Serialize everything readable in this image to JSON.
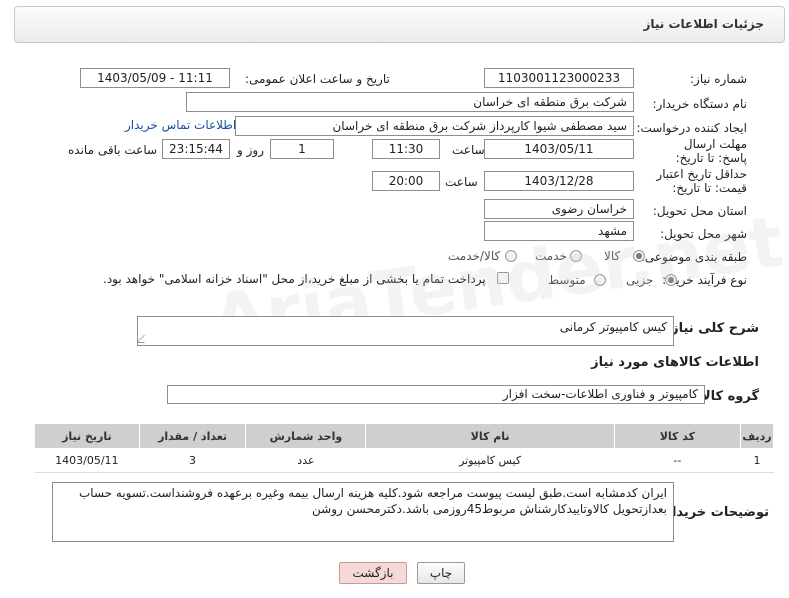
{
  "header": {
    "title": "جزئیات اطلاعات نیاز"
  },
  "need_number": {
    "label": "شماره نیاز:",
    "value": "1103001123000233"
  },
  "announce": {
    "label": "تاریخ و ساعت اعلان عمومی:",
    "value": "1403/05/09 - 11:11"
  },
  "buyer_org": {
    "label": "نام دستگاه خریدار:",
    "value": "شرکت برق منطقه ای خراسان"
  },
  "requester": {
    "label": "ایجاد کننده درخواست:",
    "value": "سید مصطفی شیوا کارپرداز شرکت برق منطقه ای خراسان",
    "contact_link": "اطلاعات تماس خریدار"
  },
  "reply_deadline": {
    "label": "مهلت ارسال پاسخ: تا تاریخ:",
    "date": "1403/05/11",
    "time_label": "ساعت",
    "time": "11:30",
    "days": "1",
    "days_label": "روز و",
    "remaining": "23:15:44",
    "remaining_label": "ساعت باقی مانده"
  },
  "price_validity": {
    "label": "حداقل تاریخ اعتبار قیمت: تا تاریخ:",
    "date": "1403/12/28",
    "time_label": "ساعت",
    "time": "20:00"
  },
  "province": {
    "label": "استان محل تحویل:",
    "value": "خراسان رضوی"
  },
  "city": {
    "label": "شهر محل تحویل:",
    "value": "مشهد"
  },
  "category": {
    "label": "طبقه بندی موضوعی:",
    "options": [
      "کالا",
      "خدمت",
      "کالا/خدمت"
    ]
  },
  "purchase_type": {
    "label": "نوع فرآیند خرید :",
    "options": [
      "جزیی",
      "متوسط"
    ],
    "payment_note": "پرداخت تمام یا بخشی از مبلغ خرید،از محل \"اسناد خزانه اسلامی\" خواهد بود."
  },
  "description": {
    "label": "شرح کلی نیاز:",
    "value": "کیس کامپیوتر کرمانی"
  },
  "goods_section": {
    "title": "اطلاعات کالاهای مورد نیاز"
  },
  "goods_group": {
    "label": "گروه کالا:",
    "value": "کامپیوتر و فناوری اطلاعات-سخت افزار"
  },
  "table": {
    "headers": [
      "ردیف",
      "کد کالا",
      "نام کالا",
      "واحد شمارش",
      "تعداد / مقدار",
      "تاریخ نیاز"
    ],
    "rows": [
      [
        "1",
        "--",
        "کیس کامپیوتر",
        "عدد",
        "3",
        "1403/05/11"
      ]
    ]
  },
  "buyer_notes": {
    "label": "توضیحات خریدار:",
    "value": "ایران کدمشابه است.طبق لیست پیوست مراجعه شود.کلیه هزینه ارسال بیمه وغیره برعهده فروشنداست.تسویه حساب بعدازتحویل کالاوتاییدکارشناش مربوط45روزمی باشد.دکترمحسن روشن"
  },
  "buttons": {
    "print": "چاپ",
    "back": "بازگشت"
  },
  "watermark": "AriaTender.net"
}
